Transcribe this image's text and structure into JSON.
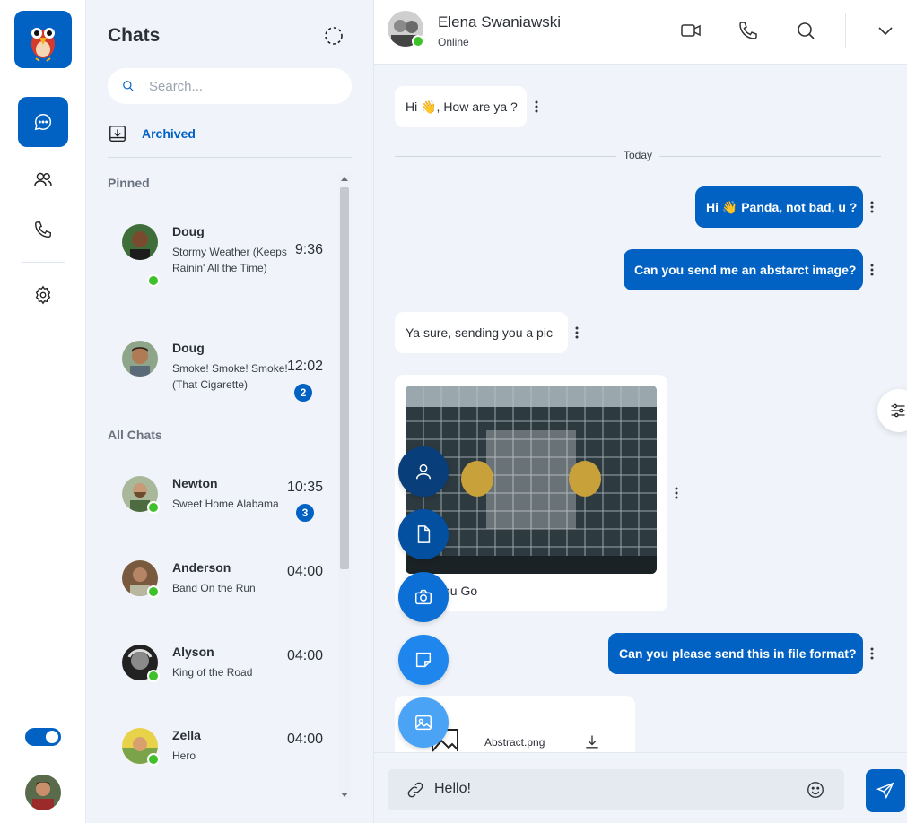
{
  "nav": {
    "items": [
      "chat-icon",
      "users-icon",
      "phone-icon",
      "gear-icon"
    ],
    "theme_toggle": "on"
  },
  "chats": {
    "title": "Chats",
    "search_placeholder": "Search...",
    "archived_label": "Archived",
    "pinned_label": "Pinned",
    "all_label": "All Chats",
    "pinned": [
      {
        "name": "Doug",
        "message": "Stormy Weather (Keeps Rainin' All the Time)",
        "time": "9:36",
        "badge": "",
        "online": true
      },
      {
        "name": "Doug",
        "message": "Smoke! Smoke! Smoke! (That Cigarette)",
        "time": "12:02",
        "badge": "2",
        "online": false
      }
    ],
    "all": [
      {
        "name": "Newton",
        "message": "Sweet Home Alabama",
        "time": "10:35",
        "badge": "3",
        "online": true
      },
      {
        "name": "Anderson",
        "message": "Band On the Run",
        "time": "04:00",
        "badge": "",
        "online": true
      },
      {
        "name": "Alyson",
        "message": "King of the Road",
        "time": "04:00",
        "badge": "",
        "online": true
      },
      {
        "name": "Zella",
        "message": "Hero",
        "time": "04:00",
        "badge": "",
        "online": true
      }
    ]
  },
  "conversation": {
    "contact_name": "Elena Swaniawski",
    "contact_status": "Online",
    "date_divider": "Today",
    "messages": [
      {
        "dir": "in",
        "text": "Hi 👋, How are ya ?"
      },
      {
        "dir": "out",
        "text": "Hi 👋 Panda, not bad, u ?"
      },
      {
        "dir": "out",
        "text": "Can you send me an abstarct image?"
      },
      {
        "dir": "in",
        "text": "Ya sure, sending you a pic"
      },
      {
        "dir": "in",
        "text": "ou Go"
      },
      {
        "dir": "out",
        "text": "Can you please send this in file format?"
      }
    ],
    "file_name": "Abstract.png",
    "composer_value": "Hello!"
  },
  "colors": {
    "brand": "#0162c4",
    "online": "#3ec12a",
    "panel_bg": "#f0f4fa"
  }
}
